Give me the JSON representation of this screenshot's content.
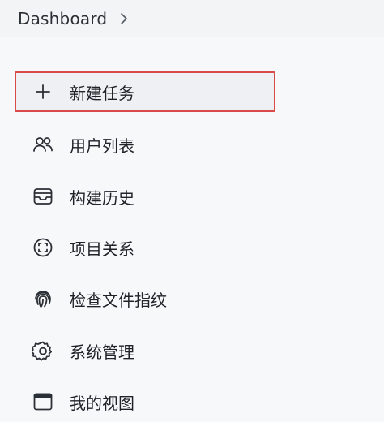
{
  "breadcrumb": {
    "label": "Dashboard",
    "chevron_icon": "chevron-right-icon"
  },
  "menu": {
    "items": [
      {
        "label": "新建任务",
        "icon": "plus-icon",
        "active": true
      },
      {
        "label": "用户列表",
        "icon": "users-icon",
        "active": false
      },
      {
        "label": "构建历史",
        "icon": "inbox-icon",
        "active": false
      },
      {
        "label": "项目关系",
        "icon": "focus-icon",
        "active": false
      },
      {
        "label": "检查文件指纹",
        "icon": "fingerprint-icon",
        "active": false
      },
      {
        "label": "系统管理",
        "icon": "gear-icon",
        "active": false
      },
      {
        "label": "我的视图",
        "icon": "window-icon",
        "active": false
      }
    ]
  },
  "colors": {
    "active_border": "#d94a4a",
    "active_bg": "#eef0f4",
    "text": "#1f2329"
  }
}
